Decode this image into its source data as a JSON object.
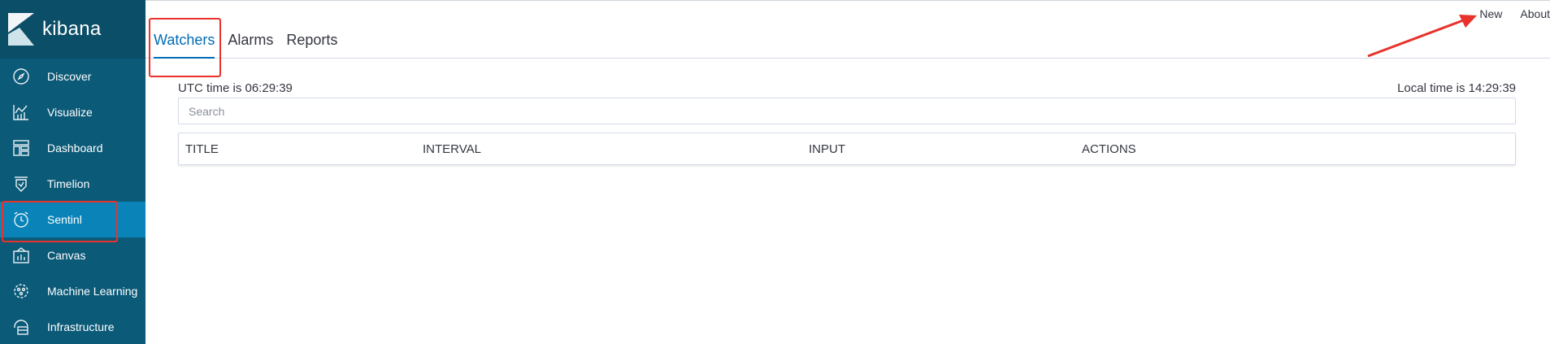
{
  "brand": {
    "name": "kibana"
  },
  "sidebar": {
    "items": [
      {
        "label": "Discover",
        "icon": "compass-icon"
      },
      {
        "label": "Visualize",
        "icon": "chart-icon"
      },
      {
        "label": "Dashboard",
        "icon": "dashboard-icon"
      },
      {
        "label": "Timelion",
        "icon": "timelion-icon"
      },
      {
        "label": "Sentinl",
        "icon": "alarm-clock-icon",
        "active": true
      },
      {
        "label": "Canvas",
        "icon": "canvas-icon"
      },
      {
        "label": "Machine Learning",
        "icon": "machine-learning-icon"
      },
      {
        "label": "Infrastructure",
        "icon": "infrastructure-icon"
      }
    ]
  },
  "tabs": [
    {
      "label": "Watchers",
      "active": true
    },
    {
      "label": "Alarms"
    },
    {
      "label": "Reports"
    }
  ],
  "top_links": {
    "new": "New",
    "about": "About"
  },
  "times": {
    "utc": "UTC time is 06:29:39",
    "local": "Local time is 14:29:39"
  },
  "search": {
    "placeholder": "Search",
    "value": ""
  },
  "table": {
    "headers": [
      "TITLE",
      "INTERVAL",
      "INPUT",
      "ACTIONS"
    ]
  },
  "colors": {
    "sidebar": "#0b5a78",
    "active_item": "#0a84b8",
    "accent": "#006bb4",
    "annotation": "#e8322b"
  }
}
